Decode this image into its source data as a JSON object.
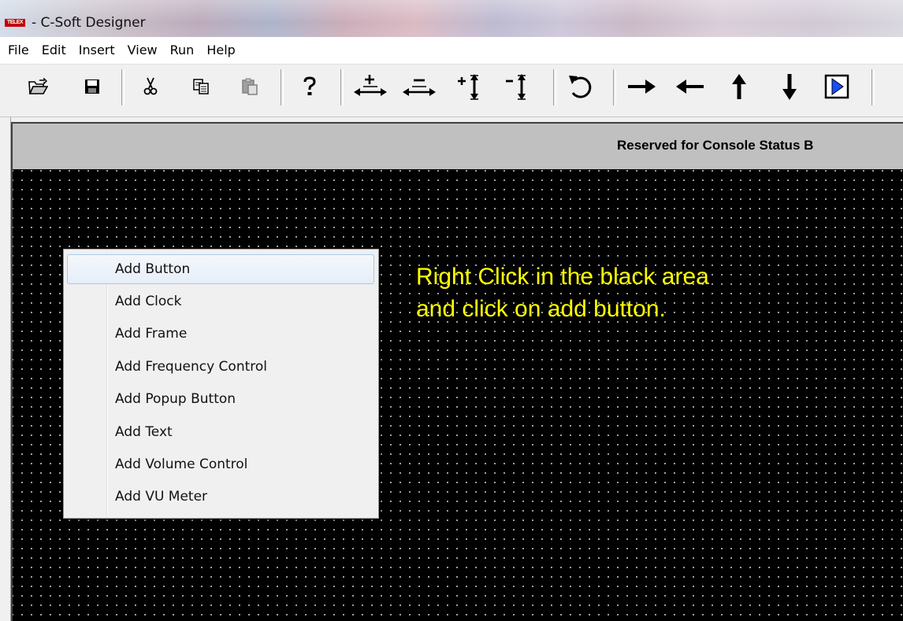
{
  "window": {
    "logo_text": "TELEX",
    "title": "- C-Soft Designer"
  },
  "menu": {
    "items": [
      "File",
      "Edit",
      "Insert",
      "View",
      "Run",
      "Help"
    ]
  },
  "toolbar": {
    "icons": [
      "open-folder-icon",
      "save-icon",
      "cut-icon",
      "copy-icon",
      "paste-icon",
      "help-icon",
      "increase-width-icon",
      "decrease-width-icon",
      "increase-height-icon",
      "decrease-height-icon",
      "undo-icon",
      "arrow-right-icon",
      "arrow-left-icon",
      "arrow-up-icon",
      "arrow-down-icon",
      "run-play-icon"
    ]
  },
  "canvas": {
    "status_strip_text": "Reserved for Console Status B",
    "instruction_text": "Right Click in the black area and click on add button."
  },
  "context_menu": {
    "items": [
      {
        "label": "Add Button",
        "highlighted": true
      },
      {
        "label": "Add Clock",
        "highlighted": false
      },
      {
        "label": "Add Frame",
        "highlighted": false
      },
      {
        "label": "Add Frequency Control",
        "highlighted": false
      },
      {
        "label": "Add Popup Button",
        "highlighted": false
      },
      {
        "label": "Add Text",
        "highlighted": false
      },
      {
        "label": "Add Volume Control",
        "highlighted": false
      },
      {
        "label": "Add VU Meter",
        "highlighted": false
      }
    ]
  },
  "colors": {
    "design_background": "#000000",
    "instruction_text": "#ffff00",
    "status_strip": "#c0c0c0",
    "menu_highlight_border": "#a8c8ea"
  }
}
